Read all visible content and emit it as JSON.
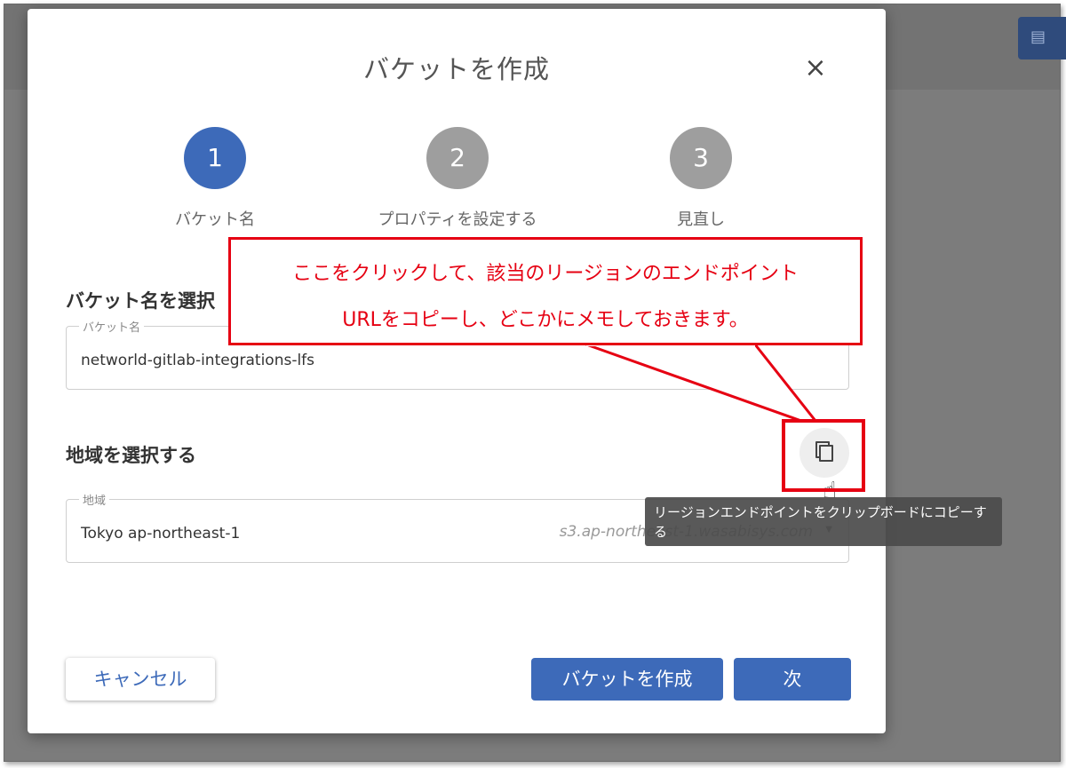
{
  "dialog": {
    "title": "バケットを作成",
    "close_icon": "×"
  },
  "steps": [
    {
      "number": "1",
      "label": "バケット名",
      "state": "active"
    },
    {
      "number": "2",
      "label": "プロパティを設定する",
      "state": "inactive"
    },
    {
      "number": "3",
      "label": "見直し",
      "state": "inactive"
    }
  ],
  "bucket_section": {
    "title": "バケット名を選択",
    "field_label": "バケット名",
    "value": "networld-gitlab-integrations-lfs"
  },
  "region_section": {
    "title": "地域を選択する",
    "field_label": "地域",
    "value": "Tokyo ap-northeast-1",
    "endpoint": "s3.ap-northeast-1.wasabisys.com"
  },
  "tooltip": {
    "text": "リージョンエンドポイントをクリップボードにコピーする"
  },
  "callout": {
    "line1": "ここをクリックして、該当のリージョンのエンドポイント",
    "line2": "URLをコピーし、どこかにメモしておきます。"
  },
  "buttons": {
    "cancel": "キャンセル",
    "create": "バケットを作成",
    "next": "次"
  },
  "colors": {
    "primary": "#3d6ab9",
    "annotation": "#e60012",
    "inactive_step": "#9e9e9e"
  }
}
